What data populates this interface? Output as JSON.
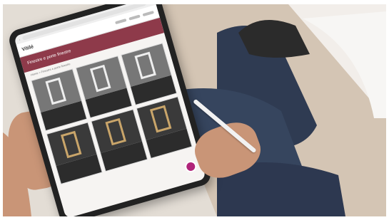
{
  "tablet_screen": {
    "logo": "Vitilé",
    "hero_title": "Finestre e porte finestre",
    "breadcrumb": "Home > Finestre e porte finestre"
  },
  "colors": {
    "hero_bar": "#8e3a4a",
    "chat_button": "#b0247a"
  },
  "icons": [
    "chat-bubble-icon",
    "back-arrow-icon",
    "share-icon"
  ]
}
